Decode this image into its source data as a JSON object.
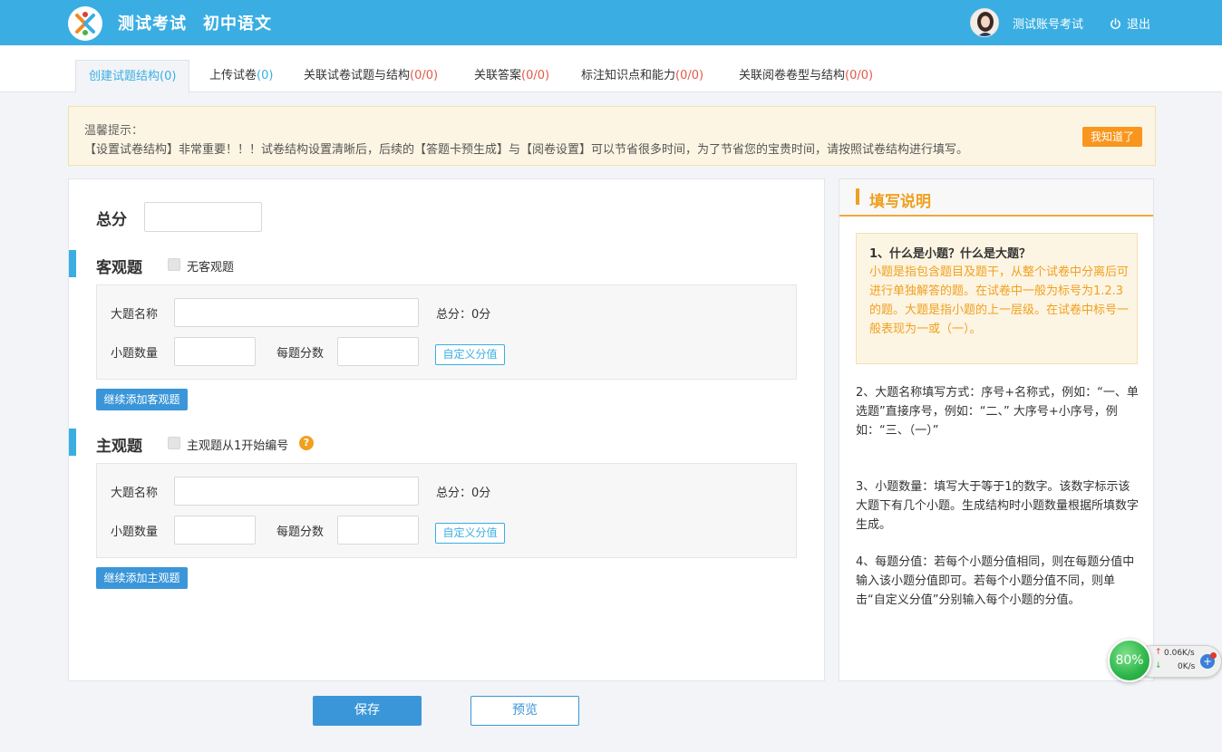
{
  "header": {
    "brand": "测试考试",
    "subject": "初中语文",
    "user_name": "测试账号考试",
    "logout_label": "退出"
  },
  "tabs": [
    {
      "label": "创建试题结构",
      "count": "(0)"
    },
    {
      "label": "上传试卷",
      "count": "(0)"
    },
    {
      "label": "关联试卷试题与结构",
      "count": "(0/0)"
    },
    {
      "label": "关联答案",
      "count": "(0/0)"
    },
    {
      "label": "标注知识点和能力",
      "count": "(0/0)"
    },
    {
      "label": "关联阅卷卷型与结构",
      "count": "(0/0)"
    }
  ],
  "notice": {
    "title": "温馨提示：",
    "text": "【设置试卷结构】非常重要！！！试卷结构设置清晰后，后续的【答题卡预生成】与【阅卷设置】可以节省很多时间，为了节省您的宝贵时间，请按照试卷结构进行填写。",
    "button": "我知道了"
  },
  "form": {
    "total_label": "总分",
    "objective": {
      "title": "客观题",
      "checkbox_label": "无客观题",
      "name_label": "大题名称",
      "total_text": "总分：0分",
      "count_label": "小题数量",
      "score_label": "每题分数",
      "custom_button": "自定义分值",
      "add_button": "继续添加客观题"
    },
    "subjective": {
      "title": "主观题",
      "checkbox_label": "主观题从1开始编号",
      "help": "?",
      "name_label": "大题名称",
      "total_text": "总分：0分",
      "count_label": "小题数量",
      "score_label": "每题分数",
      "custom_button": "自定义分值",
      "add_button": "继续添加主观题"
    }
  },
  "side": {
    "title": "填写说明",
    "q1_title": "1、什么是小题？什么是大题？",
    "q1_body": "小题是指包含题目及题干，从整个试卷中分离后可进行单独解答的题。在试卷中一般为标号为1.2.3的题。大题是指小题的上一层级。在试卷中标号一般表现为一或（一）。",
    "s2": "2、大题名称填写方式：序号+名称式，例如：“一、单选题”直接序号，例如：“二、” 大序号+小序号，例如：“三、（一）”",
    "s3": "3、小题数量：填写大于等于1的数字。该数字标示该大题下有几个小题。生成结构时小题数量根据所填数字生成。",
    "s4": "4、每题分值：若每个小题分值相同，则在每题分值中输入该小题分值即可。若每个小题分值不同，则单击“自定义分值”分别输入每个小题的分值。"
  },
  "bottom": {
    "save": "保存",
    "preview": "预览"
  },
  "speed_widget": {
    "percent": "80%",
    "up": "0.06K/s",
    "down": "0K/s"
  }
}
